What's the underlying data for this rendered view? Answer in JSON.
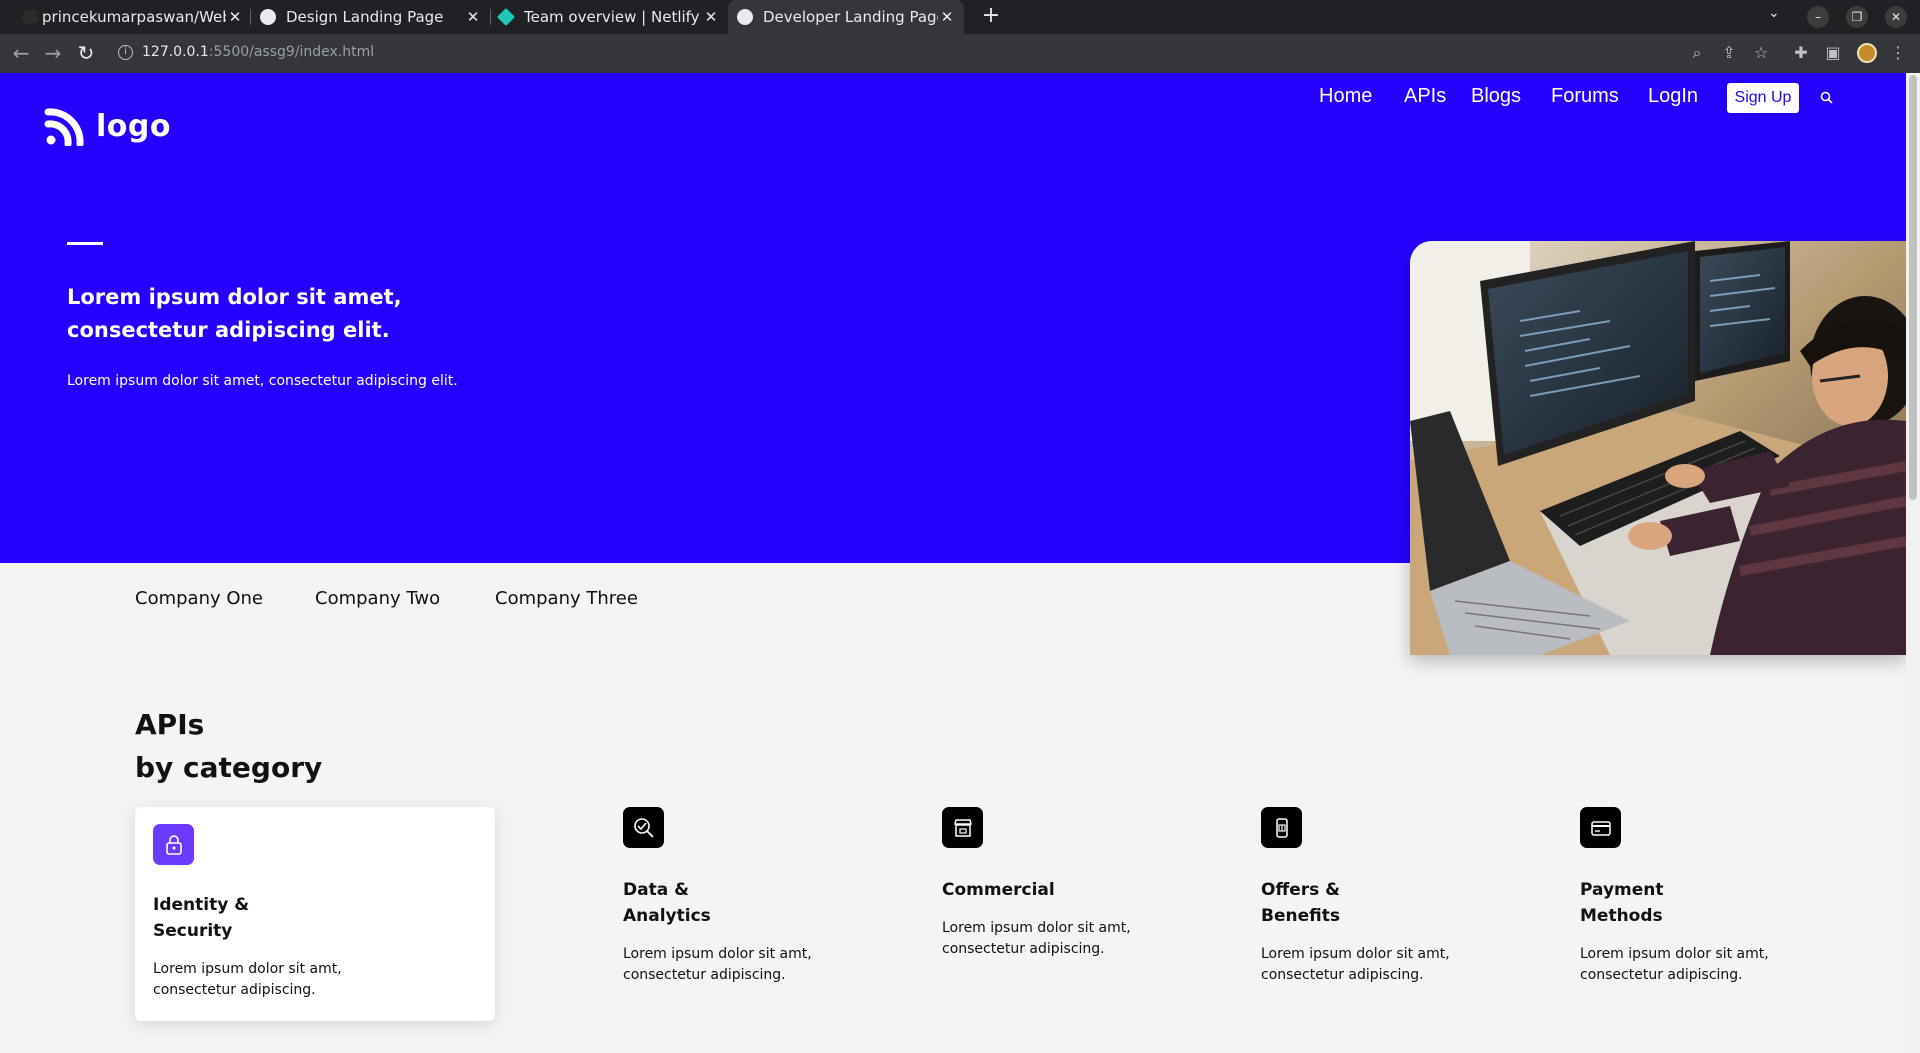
{
  "browser": {
    "tabs": [
      {
        "title": "princekumarpaswan/Web"
      },
      {
        "title": "Design Landing Page"
      },
      {
        "title": "Team overview | Netlify"
      },
      {
        "title": "Developer Landing Page"
      }
    ],
    "url_host": "127.0.0.1",
    "url_rest": ":5500/assg9/index.html"
  },
  "site": {
    "logo_text": "logo",
    "nav": [
      "Home",
      "APIs",
      "Blogs",
      "Forums",
      "LogIn"
    ],
    "signup_label": "Sign Up"
  },
  "hero": {
    "title": "Lorem ipsum dolor sit amet, consectetur adipiscing elit.",
    "subtitle": "Lorem ipsum dolor sit amet, consectetur adipiscing elit."
  },
  "companies": [
    "Company One",
    "Company Two",
    "Company Three"
  ],
  "apis": {
    "title_line1": "APIs",
    "title_line2": "by category",
    "cards": [
      {
        "title": "Identity & Security",
        "desc": "Lorem ipsum dolor sit amt, consectetur adipiscing.",
        "icon": "lock-icon"
      },
      {
        "title": "Data & Analytics",
        "desc": "Lorem ipsum dolor sit amt, consectetur adipiscing.",
        "icon": "analytics-icon"
      },
      {
        "title": "Commercial",
        "desc": "Lorem ipsum dolor sit amt, consectetur adipiscing.",
        "icon": "store-icon"
      },
      {
        "title": "Offers & Benefits",
        "desc": "Lorem ipsum dolor sit amt, consectetur adipiscing.",
        "icon": "gift-phone-icon"
      },
      {
        "title": "Payment Methods",
        "desc": "Lorem ipsum dolor sit amt, consectetur adipiscing.",
        "icon": "card-icon"
      }
    ]
  },
  "colors": {
    "hero_bg": "#2600ff",
    "active_icon_bg": "#6c3aff",
    "page_bg": "#f4f4f4"
  }
}
